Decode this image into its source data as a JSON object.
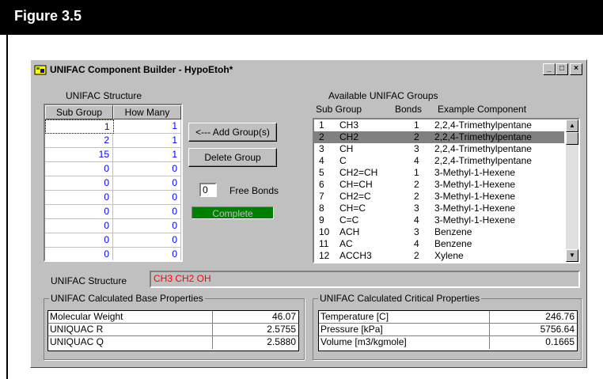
{
  "figure": {
    "label": "Figure 3.5"
  },
  "window": {
    "title": "UNIFAC Component Builder - HypoEtoh*",
    "controls": {
      "minimize": "_",
      "maximize": "□",
      "close": "×"
    }
  },
  "structure_table": {
    "title": "UNIFAC Structure",
    "columns": [
      "Sub Group",
      "How Many"
    ],
    "rows": [
      [
        "1",
        "1"
      ],
      [
        "2",
        "1"
      ],
      [
        "15",
        "1"
      ],
      [
        "0",
        "0"
      ],
      [
        "0",
        "0"
      ],
      [
        "0",
        "0"
      ],
      [
        "0",
        "0"
      ],
      [
        "0",
        "0"
      ],
      [
        "0",
        "0"
      ],
      [
        "0",
        "0"
      ]
    ]
  },
  "buttons": {
    "add_group": "<--- Add Group(s)",
    "delete_group": "Delete Group"
  },
  "free_bonds": {
    "value": "0",
    "label": "Free Bonds"
  },
  "status": {
    "text": "Complete",
    "color": "#008000"
  },
  "groups": {
    "title": "Available UNIFAC Groups",
    "columns": [
      "Sub Group",
      "Bonds",
      "Example Component"
    ],
    "selected_index": 1,
    "rows": [
      [
        "1",
        "CH3",
        "1",
        "2,2,4-Trimethylpentane"
      ],
      [
        "2",
        "CH2",
        "2",
        "2,2,4-Trimethylpentane"
      ],
      [
        "3",
        "CH",
        "3",
        "2,2,4-Trimethylpentane"
      ],
      [
        "4",
        "C",
        "4",
        "2,2,4-Trimethylpentane"
      ],
      [
        "5",
        "CH2=CH",
        "1",
        "3-Methyl-1-Hexene"
      ],
      [
        "6",
        "CH=CH",
        "2",
        "3-Methyl-1-Hexene"
      ],
      [
        "7",
        "CH2=C",
        "2",
        "3-Methyl-1-Hexene"
      ],
      [
        "8",
        "CH=C",
        "3",
        "3-Methyl-1-Hexene"
      ],
      [
        "9",
        "C=C",
        "4",
        "3-Methyl-1-Hexene"
      ],
      [
        "10",
        "ACH",
        "3",
        "Benzene"
      ],
      [
        "11",
        "AC",
        "4",
        "Benzene"
      ],
      [
        "12",
        "ACCH3",
        "2",
        "Xylene"
      ]
    ]
  },
  "unifac_structure": {
    "label": "UNIFAC Structure",
    "value": "CH3 CH2 OH",
    "value_color": "#ff0000"
  },
  "base_properties": {
    "title": "UNIFAC Calculated Base Properties",
    "rows": [
      [
        "Molecular Weight",
        "46.07"
      ],
      [
        "UNIQUAC R",
        "2.5755"
      ],
      [
        "UNIQUAC Q",
        "2.5880"
      ]
    ]
  },
  "critical_properties": {
    "title": "UNIFAC Calculated Critical Properties",
    "rows": [
      [
        "Temperature [C]",
        "246.76"
      ],
      [
        "Pressure [kPa]",
        "5756.64"
      ],
      [
        "Volume [m3/kgmole]",
        "0.1665"
      ]
    ]
  },
  "icons": [
    "app-icon",
    "scroll-up-icon",
    "scroll-down-icon"
  ]
}
